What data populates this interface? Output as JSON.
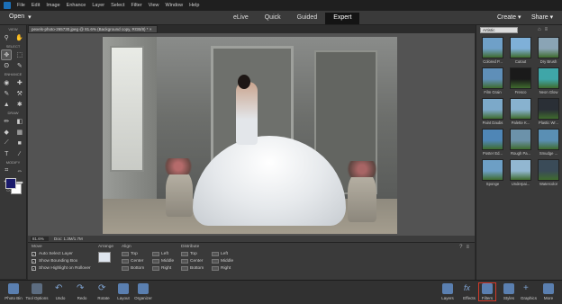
{
  "menubar": {
    "items": [
      "File",
      "Edit",
      "Image",
      "Enhance",
      "Layer",
      "Select",
      "Filter",
      "View",
      "Window",
      "Help"
    ]
  },
  "topbar": {
    "open": "Open",
    "modes": [
      "eLive",
      "Quick",
      "Guided",
      "Expert"
    ],
    "active_mode": "Expert",
    "create": "Create",
    "share": "Share"
  },
  "toolbox": {
    "sections": [
      "VIEW",
      "SELECT",
      "ENHANCE",
      "DRAW",
      "MODIFY",
      "COLOR"
    ]
  },
  "document": {
    "tab": "pexels-photo-265730.jpeg @ 81.6% (Background copy, RGB/8) *"
  },
  "status": {
    "zoom": "81.6%",
    "doc": "Doc: 1.3M/1.7M"
  },
  "options": {
    "move": {
      "title": "Move",
      "checks": [
        "Auto Select Layer",
        "Show Bounding Box",
        "Show Highlight on Rollover"
      ]
    },
    "arrange": {
      "title": "Arrange"
    },
    "align": {
      "title": "Align",
      "items": [
        "Top",
        "Left",
        "Center",
        "Middle",
        "Bottom",
        "Right"
      ]
    },
    "distribute": {
      "title": "Distribute",
      "items": [
        "Top",
        "Left",
        "Center",
        "Middle",
        "Bottom",
        "Right"
      ]
    }
  },
  "panel": {
    "category": "Artistic",
    "filters": [
      {
        "label": "Colored P...",
        "color": "#6fa0c8"
      },
      {
        "label": "Cutout",
        "color": "#7fb0d8"
      },
      {
        "label": "Dry Brush",
        "color": "#8aa4b5"
      },
      {
        "label": "Film Grain",
        "color": "#5f8fb8"
      },
      {
        "label": "Fresco",
        "color": "#1a1a1a"
      },
      {
        "label": "Neon Glow",
        "color": "#3fa6a8"
      },
      {
        "label": "Paint Daubs",
        "color": "#7ca9c9"
      },
      {
        "label": "Palette K...",
        "color": "#88b2cf"
      },
      {
        "label": "Plastic Wr...",
        "color": "#2a2f36"
      },
      {
        "label": "Poster Ed...",
        "color": "#4f86b6"
      },
      {
        "label": "Rough Pa...",
        "color": "#6c92aa"
      },
      {
        "label": "Smudge ...",
        "color": "#5a8fb4"
      },
      {
        "label": "Sponge",
        "color": "#6d9fc5"
      },
      {
        "label": "Underpai...",
        "color": "#92b7d1"
      },
      {
        "label": "Watercolor",
        "color": "#3a4b58"
      }
    ]
  },
  "bottombar": {
    "left": [
      "Photo Bin",
      "Tool Options",
      "Undo",
      "Redo",
      "Rotate",
      "Layout",
      "Organizer"
    ],
    "right": [
      "Layers",
      "Effects",
      "Filters",
      "Styles",
      "Graphics",
      "More"
    ],
    "highlighted": "Filters"
  }
}
